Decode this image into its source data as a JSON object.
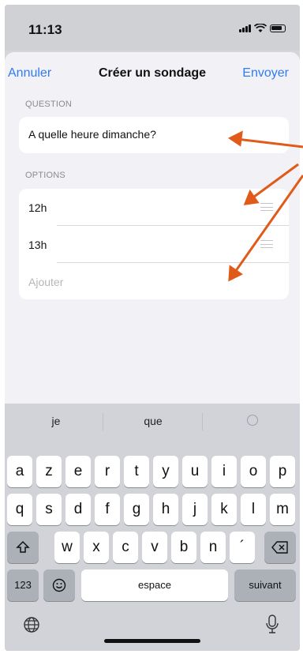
{
  "status": {
    "time": "11:13"
  },
  "nav": {
    "cancel": "Annuler",
    "title": "Créer un sondage",
    "send": "Envoyer"
  },
  "question": {
    "label": "QUESTION",
    "value": "A quelle heure dimanche?"
  },
  "options": {
    "label": "OPTIONS",
    "items": [
      "12h",
      "13h"
    ],
    "add_placeholder": "Ajouter"
  },
  "keyboard": {
    "suggestions": [
      "je",
      "que"
    ],
    "row1": [
      "a",
      "z",
      "e",
      "r",
      "t",
      "y",
      "u",
      "i",
      "o",
      "p"
    ],
    "row2": [
      "q",
      "s",
      "d",
      "f",
      "g",
      "h",
      "j",
      "k",
      "l",
      "m"
    ],
    "row3": [
      "w",
      "x",
      "c",
      "v",
      "b",
      "n",
      "´"
    ],
    "numbers": "123",
    "space": "espace",
    "next": "suivant"
  },
  "colors": {
    "accent": "#2f7bf5",
    "annotation_arrow": "#e05a1a"
  }
}
